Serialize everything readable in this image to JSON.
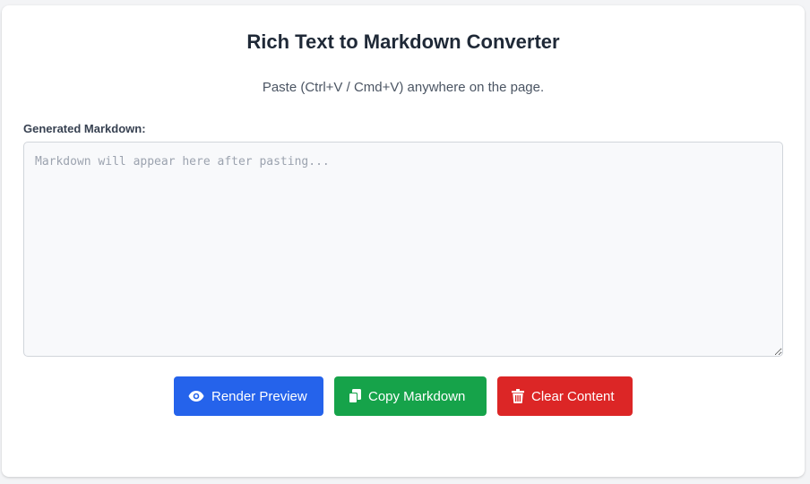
{
  "header": {
    "title": "Rich Text to Markdown Converter",
    "subtitle": "Paste (Ctrl+V / Cmd+V) anywhere on the page."
  },
  "output": {
    "label": "Generated Markdown:",
    "value": "",
    "placeholder": "Markdown will appear here after pasting..."
  },
  "actions": {
    "render_label": "Render Preview",
    "render_icon": "eye-icon",
    "copy_label": "Copy Markdown",
    "copy_icon": "copy-icon",
    "clear_label": "Clear Content",
    "clear_icon": "trash-icon"
  },
  "colors": {
    "render": "#2563eb",
    "copy": "#16a34a",
    "clear": "#dc2626",
    "background": "#f3f4f6",
    "card": "#ffffff"
  }
}
